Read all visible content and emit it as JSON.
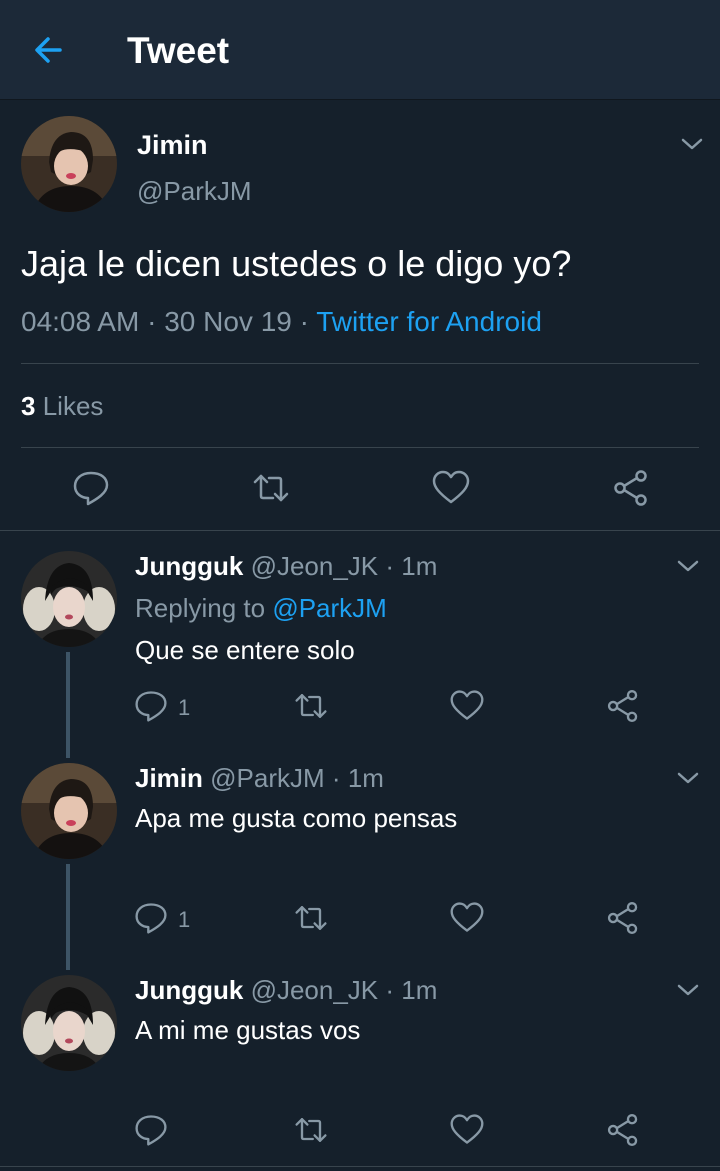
{
  "header": {
    "title": "Tweet"
  },
  "main_tweet": {
    "name": "Jimin",
    "handle": "@ParkJM",
    "text": "Jaja le dicen ustedes o le digo yo?",
    "time": "04:08 AM",
    "date": "30 Nov 19",
    "source": "Twitter for Android",
    "likes_count": "3",
    "likes_label": "Likes",
    "meta_sep": "·"
  },
  "replies": [
    {
      "name": "Jungguk",
      "handle": "@Jeon_JK",
      "time": "1m",
      "replying_prefix": "Replying to",
      "replying_to": "@ParkJM",
      "text": "Que se entere solo",
      "reply_count": "1"
    },
    {
      "name": "Jimin",
      "handle": "@ParkJM",
      "time": "1m",
      "text": "Apa me gusta como pensas",
      "reply_count": "1"
    },
    {
      "name": "Jungguk",
      "handle": "@Jeon_JK",
      "time": "1m",
      "text": "A mi me gustas vos"
    }
  ],
  "icons": {
    "back": "arrow-left-icon",
    "more": "chevron-down-icon",
    "reply": "reply-bubble-icon",
    "retweet": "retweet-icon",
    "like": "heart-icon",
    "share": "share-icon"
  },
  "colors": {
    "background": "#15202b",
    "header": "#1c2938",
    "accent": "#1da1f2",
    "secondary_text": "#8899a6",
    "divider": "#38444d"
  }
}
